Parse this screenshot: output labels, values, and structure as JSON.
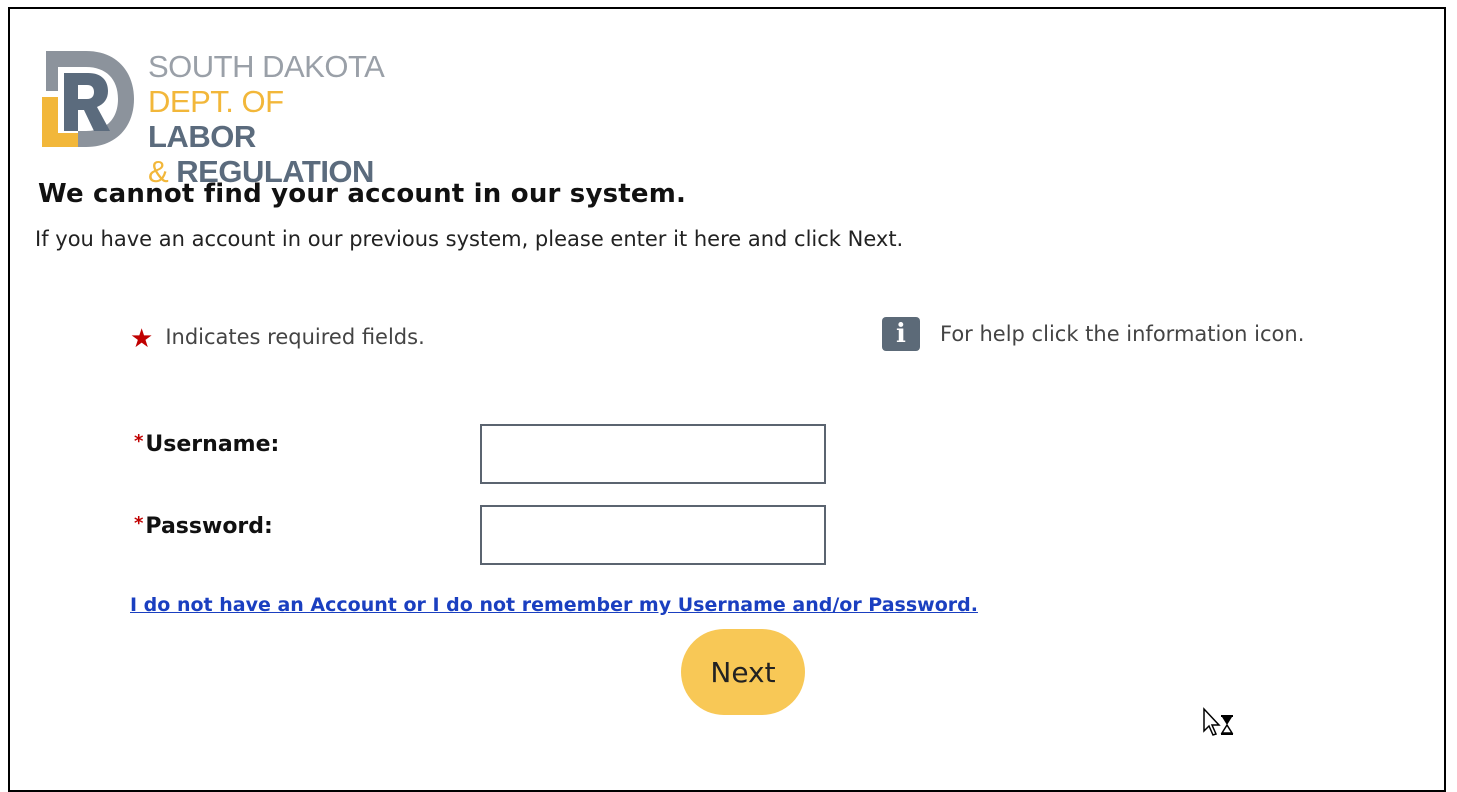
{
  "logo": {
    "line1": "SOUTH DAKOTA",
    "line2_light": "DEPT. OF ",
    "line2_bold": "LABOR",
    "line3_amp": "& ",
    "line3_bold": "REGULATION",
    "colors": {
      "gray": "#9aa0a8",
      "gold": "#f2b73a",
      "slate": "#5b6b7d"
    }
  },
  "heading": "We cannot find your account in our system.",
  "subtext": "If you have an account in our previous system, please enter it here and click Next.",
  "required_note": {
    "star": "★",
    "text": "Indicates required fields."
  },
  "help_note": {
    "icon": "i",
    "text": "For help click the information icon."
  },
  "form": {
    "username": {
      "star": "*",
      "label": "Username:",
      "value": ""
    },
    "password": {
      "star": "*",
      "label": "Password:",
      "value": ""
    }
  },
  "recovery_link": "I do not have an Account or I do not remember my Username and/or Password.",
  "next_button": "Next",
  "colors": {
    "accent_button": "#f8c856",
    "required_star": "#c00000",
    "link": "#1a3fc0",
    "info_icon_bg": "#5c6a78"
  }
}
